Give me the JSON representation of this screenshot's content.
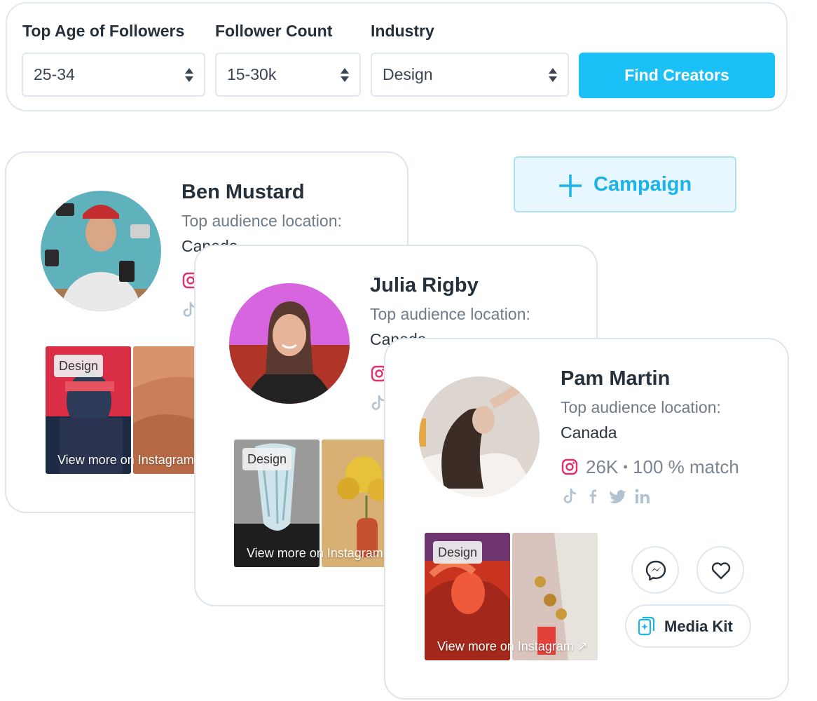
{
  "filters": {
    "age": {
      "label": "Top Age of Followers",
      "value": "25-34"
    },
    "followers": {
      "label": "Follower Count",
      "value": "15-30k"
    },
    "industry": {
      "label": "Industry",
      "value": "Design"
    },
    "find_button": "Find Creators"
  },
  "campaign_button": "Campaign",
  "creators": [
    {
      "name": "Ben Mustard",
      "location_label": "Top audience location:",
      "location": "Canada",
      "tag": "Design",
      "view_more": "View more on Instagram"
    },
    {
      "name": "Julia Rigby",
      "location_label": "Top audience location:",
      "location": "Canada",
      "tag": "Design",
      "view_more": "View more on Instagram"
    },
    {
      "name": "Pam Martin",
      "location_label": "Top audience location:",
      "location": "Canada",
      "followers": "26K",
      "separator": "•",
      "match": "100 % match",
      "tag": "Design",
      "view_more": "View more on Instagram ↗",
      "media_kit": "Media Kit"
    }
  ],
  "icons": [
    "chevron-up-down-icon",
    "plus-icon",
    "instagram-icon",
    "tiktok-icon",
    "facebook-icon",
    "twitter-icon",
    "linkedin-icon",
    "messenger-icon",
    "heart-icon",
    "media-kit-icon"
  ],
  "colors": {
    "accent": "#1bc0f6",
    "instagram": "#e1306c",
    "social_muted": "#b3c2cf"
  }
}
